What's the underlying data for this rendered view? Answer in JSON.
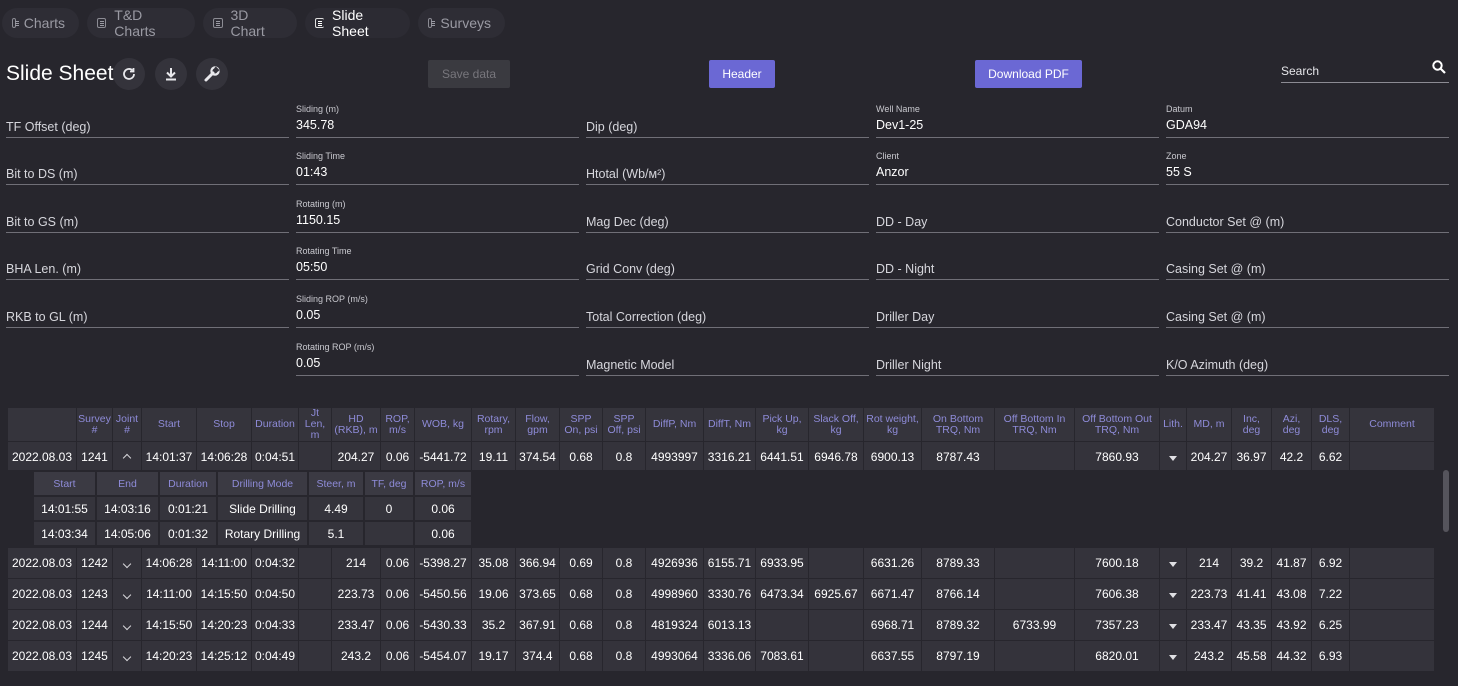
{
  "tabs": [
    {
      "label": "Charts",
      "icon": "chart-icon"
    },
    {
      "label": "T&D Charts",
      "icon": "chart-icon"
    },
    {
      "label": "3D Chart",
      "icon": "chart-icon"
    },
    {
      "label": "Slide Sheet",
      "icon": "sheet-icon"
    },
    {
      "label": "Surveys",
      "icon": "document-icon"
    }
  ],
  "header": {
    "title": "Slide Sheet",
    "save_label": "Save data",
    "header_label": "Header",
    "download_label": "Download PDF",
    "search_placeholder": "Search"
  },
  "colors": {
    "accent": "#6b68d4",
    "background": "#27262d",
    "cell": "#34333b",
    "header_text": "#8e8bd8"
  },
  "form": {
    "col1": [
      {
        "label": "TF Offset (deg)",
        "value": ""
      },
      {
        "label": "Bit to DS (m)",
        "value": ""
      },
      {
        "label": "Bit to GS (m)",
        "value": ""
      },
      {
        "label": "BHA Len. (m)",
        "value": ""
      },
      {
        "label": "RKB to GL (m)",
        "value": ""
      }
    ],
    "col2": [
      {
        "label": "Sliding (m)",
        "value": "345.78"
      },
      {
        "label": "Sliding Time",
        "value": "01:43"
      },
      {
        "label": "Rotating (m)",
        "value": "1150.15"
      },
      {
        "label": "Rotating Time",
        "value": "05:50"
      },
      {
        "label": "Sliding ROP (m/s)",
        "value": "0.05"
      },
      {
        "label": "Rotating ROP (m/s)",
        "value": "0.05"
      }
    ],
    "col3": [
      {
        "label": "Dip (deg)",
        "value": ""
      },
      {
        "label": "Htotal (Wb/м²)",
        "value": ""
      },
      {
        "label": "Mag Dec (deg)",
        "value": ""
      },
      {
        "label": "Grid Conv (deg)",
        "value": ""
      },
      {
        "label": "Total Correction (deg)",
        "value": ""
      },
      {
        "label": "Magnetic Model",
        "value": ""
      }
    ],
    "col4": [
      {
        "label": "Well Name",
        "value": "Dev1-25"
      },
      {
        "label": "Client",
        "value": "Anzor"
      },
      {
        "label": "DD - Day",
        "value": ""
      },
      {
        "label": "DD - Night",
        "value": ""
      },
      {
        "label": "Driller Day",
        "value": ""
      },
      {
        "label": "Driller Night",
        "value": ""
      }
    ],
    "col5": [
      {
        "label": "Datum",
        "value": "GDA94"
      },
      {
        "label": "Zone",
        "value": "55 S"
      },
      {
        "label": "Conductor Set @ (m)",
        "value": ""
      },
      {
        "label": "Casing Set @ (m)",
        "value": ""
      },
      {
        "label": "Casing Set @ (m)",
        "value": ""
      },
      {
        "label": "K/O Azimuth (deg)",
        "value": ""
      }
    ]
  },
  "table": {
    "columns": [
      "",
      "Survey #",
      "Joint #",
      "Start",
      "Stop",
      "Duration",
      "Jt Len, m",
      "HD (RKB), m",
      "ROP, m/s",
      "WOB, kg",
      "Rotary, rpm",
      "Flow, gpm",
      "SPP On, psi",
      "SPP Off, psi",
      "DiffP, Nm",
      "DiffT, Nm",
      "Pick Up, kg",
      "Slack Off, kg",
      "Rot weight, kg",
      "On Bottom TRQ, Nm",
      "Off Bottom In TRQ, Nm",
      "Off Bottom Out TRQ, Nm",
      "Lith.",
      "MD, m",
      "Inc, deg",
      "Azi, deg",
      "DLS, deg",
      "Comment"
    ],
    "rows": [
      [
        "2022.08.03",
        "1241",
        "up",
        "14:01:37",
        "14:06:28",
        "0:04:51",
        "",
        "204.27",
        "0.06",
        "-5441.72",
        "19.11",
        "374.54",
        "0.68",
        "0.8",
        "4993997",
        "3316.21",
        "6441.51",
        "6946.78",
        "6900.13",
        "8787.43",
        "",
        "7860.93",
        "caret",
        "204.27",
        "36.97",
        "42.2",
        "6.62",
        ""
      ],
      [
        "2022.08.03",
        "1242",
        "down",
        "14:06:28",
        "14:11:00",
        "0:04:32",
        "",
        "214",
        "0.06",
        "-5398.27",
        "35.08",
        "366.94",
        "0.69",
        "0.8",
        "4926936",
        "6155.71",
        "6933.95",
        "",
        "6631.26",
        "8789.33",
        "",
        "7600.18",
        "caret",
        "214",
        "39.2",
        "41.87",
        "6.92",
        ""
      ],
      [
        "2022.08.03",
        "1243",
        "down",
        "14:11:00",
        "14:15:50",
        "0:04:50",
        "",
        "223.73",
        "0.06",
        "-5450.56",
        "19.06",
        "373.65",
        "0.68",
        "0.8",
        "4998960",
        "3330.76",
        "6473.34",
        "6925.67",
        "6671.47",
        "8766.14",
        "",
        "7606.38",
        "caret",
        "223.73",
        "41.41",
        "43.08",
        "7.22",
        ""
      ],
      [
        "2022.08.03",
        "1244",
        "down",
        "14:15:50",
        "14:20:23",
        "0:04:33",
        "",
        "233.47",
        "0.06",
        "-5430.33",
        "35.2",
        "367.91",
        "0.68",
        "0.8",
        "4819324",
        "6013.13",
        "",
        "",
        "6968.71",
        "8789.32",
        "6733.99",
        "7357.23",
        "caret",
        "233.47",
        "43.35",
        "43.92",
        "6.25",
        ""
      ],
      [
        "2022.08.03",
        "1245",
        "down",
        "14:20:23",
        "14:25:12",
        "0:04:49",
        "",
        "243.2",
        "0.06",
        "-5454.07",
        "19.17",
        "374.4",
        "0.68",
        "0.8",
        "4993064",
        "3336.06",
        "7083.61",
        "",
        "6637.55",
        "8797.19",
        "",
        "6820.01",
        "caret",
        "243.2",
        "45.58",
        "44.32",
        "6.93",
        ""
      ]
    ]
  },
  "subtable": {
    "columns": [
      "Start",
      "End",
      "Duration",
      "Drilling Mode",
      "Steer, m",
      "TF, deg",
      "ROP, m/s"
    ],
    "rows": [
      [
        "14:01:55",
        "14:03:16",
        "0:01:21",
        "Slide Drilling",
        "4.49",
        "0",
        "0.06"
      ],
      [
        "14:03:34",
        "14:05:06",
        "0:01:32",
        "Rotary Drilling",
        "5.1",
        "",
        "0.06"
      ]
    ]
  }
}
